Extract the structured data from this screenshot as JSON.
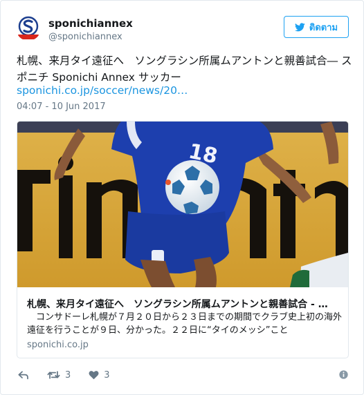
{
  "user": {
    "name": "sponichiannex",
    "handle": "@sponichiannex",
    "avatar_icon": "sponichi-s-logo-icon",
    "avatar_logo_text": "Sponichi"
  },
  "follow": {
    "label": "ติดตาม",
    "icon": "twitter-bird-icon"
  },
  "tweet": {
    "text": "札幌、来月タイ遠征へ　ソングラシン所属ムアントンと親善試合― スポニチ Sponichi Annex サッカー",
    "link": "sponichi.co.jp/soccer/news/20…",
    "timestamp": "04:07 - 10 Jun 2017"
  },
  "card": {
    "image_icon": "soccer-player-photo",
    "title": "札幌、来月タイ遠征へ　ソングラシン所属ムアントンと親善試合 - …",
    "description": "　コンサドーレ札幌が７月２０日から２３日までの期間でクラブ史上初の海外遠征を行うことが９日、分かった。２２日に“タイのメッシ”こと",
    "domain": "sponichi.co.jp"
  },
  "actions": {
    "reply_icon": "reply-icon",
    "retweet_icon": "retweet-icon",
    "retweet_count": "3",
    "like_icon": "heart-icon",
    "like_count": "3",
    "info_icon": "info-icon"
  },
  "colors": {
    "accent": "#1da1f2",
    "link": "#1b95e0",
    "muted": "#657786",
    "logo_red": "#d9261c",
    "logo_blue": "#1d3f8f"
  }
}
